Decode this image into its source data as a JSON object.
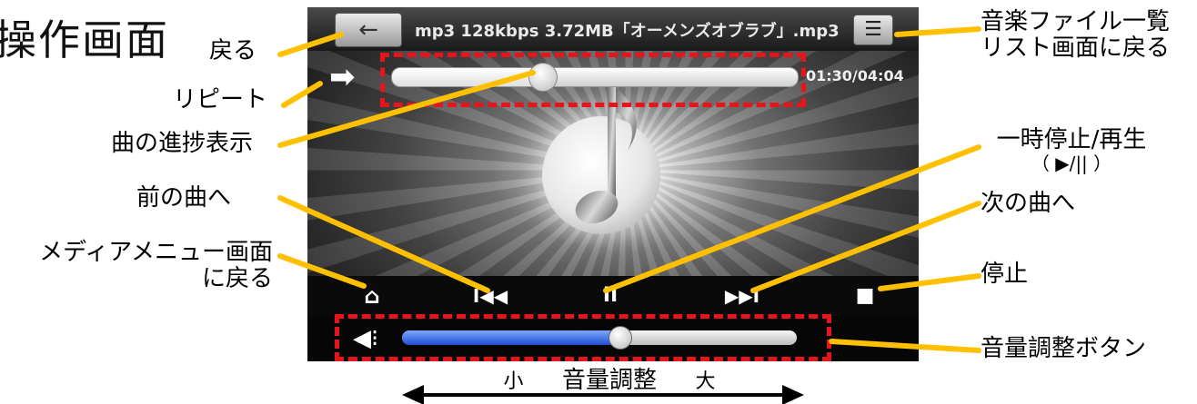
{
  "page_title": "操作画面",
  "callouts": {
    "back": "戻る",
    "repeat": "リピート",
    "progress": "曲の進捗表示",
    "prev": "前の曲へ",
    "media_menu_line1": "メディアメニュー画面",
    "media_menu_line2": "に戻る",
    "music_list_line1": "音楽ファイル一覧",
    "music_list_line2": "リスト画面に戻る",
    "pause_play": "一時停止/再生",
    "pause_play_symbols": "（ ▶/|| ）",
    "next": "次の曲へ",
    "stop": "停止",
    "volume_button": "音量調整ボタン"
  },
  "player": {
    "back_glyph": "←",
    "track_title": "mp3 128kbps 3.72MB「オーメンズオブラブ」.mp3",
    "list_glyph": "☰",
    "repeat_glyph": "➡",
    "time_readout": "01:30/04:04",
    "progress_fraction": 0.37,
    "volume_fraction": 0.55,
    "controls": {
      "home_glyph": "⌂",
      "prev_glyph": "I◀◀",
      "pause_glyph": "II",
      "next_glyph": "▶▶I",
      "stop_glyph": "■"
    },
    "volume_glyph": "◀⁝"
  },
  "volume_caption": {
    "small": "小",
    "label": "音量調整",
    "large": "大"
  },
  "colors": {
    "callout_line": "#ffc000",
    "highlight_dash": "#e8141c",
    "volume_fill": "#2a5de0"
  },
  "icons": [
    "back-arrow-icon",
    "list-icon",
    "repeat-icon",
    "music-note-icon",
    "home-icon",
    "previous-track-icon",
    "pause-icon",
    "next-track-icon",
    "stop-icon",
    "speaker-icon"
  ]
}
